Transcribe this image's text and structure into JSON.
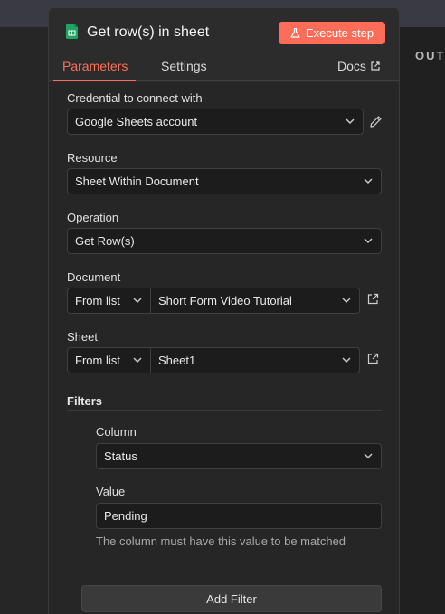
{
  "background": {
    "output_label": "OUT"
  },
  "header": {
    "title": "Get row(s) in sheet",
    "icon": "google-sheets-icon",
    "execute_label": "Execute step",
    "accent_color": "#ff6d5a"
  },
  "tabs": [
    {
      "label": "Parameters",
      "active": true
    },
    {
      "label": "Settings",
      "active": false
    }
  ],
  "docs_label": "Docs",
  "form": {
    "credential": {
      "label": "Credential to connect with",
      "value": "Google Sheets account"
    },
    "resource": {
      "label": "Resource",
      "value": "Sheet Within Document"
    },
    "operation": {
      "label": "Operation",
      "value": "Get Row(s)"
    },
    "document": {
      "label": "Document",
      "mode": "From list",
      "value": "Short Form Video Tutorial"
    },
    "sheet": {
      "label": "Sheet",
      "mode": "From list",
      "value": "Sheet1"
    },
    "filters": {
      "label": "Filters",
      "column": {
        "label": "Column",
        "value": "Status"
      },
      "value": {
        "label": "Value",
        "value": "Pending",
        "hint": "The column must have this value to be matched"
      },
      "add_filter_label": "Add Filter"
    }
  }
}
